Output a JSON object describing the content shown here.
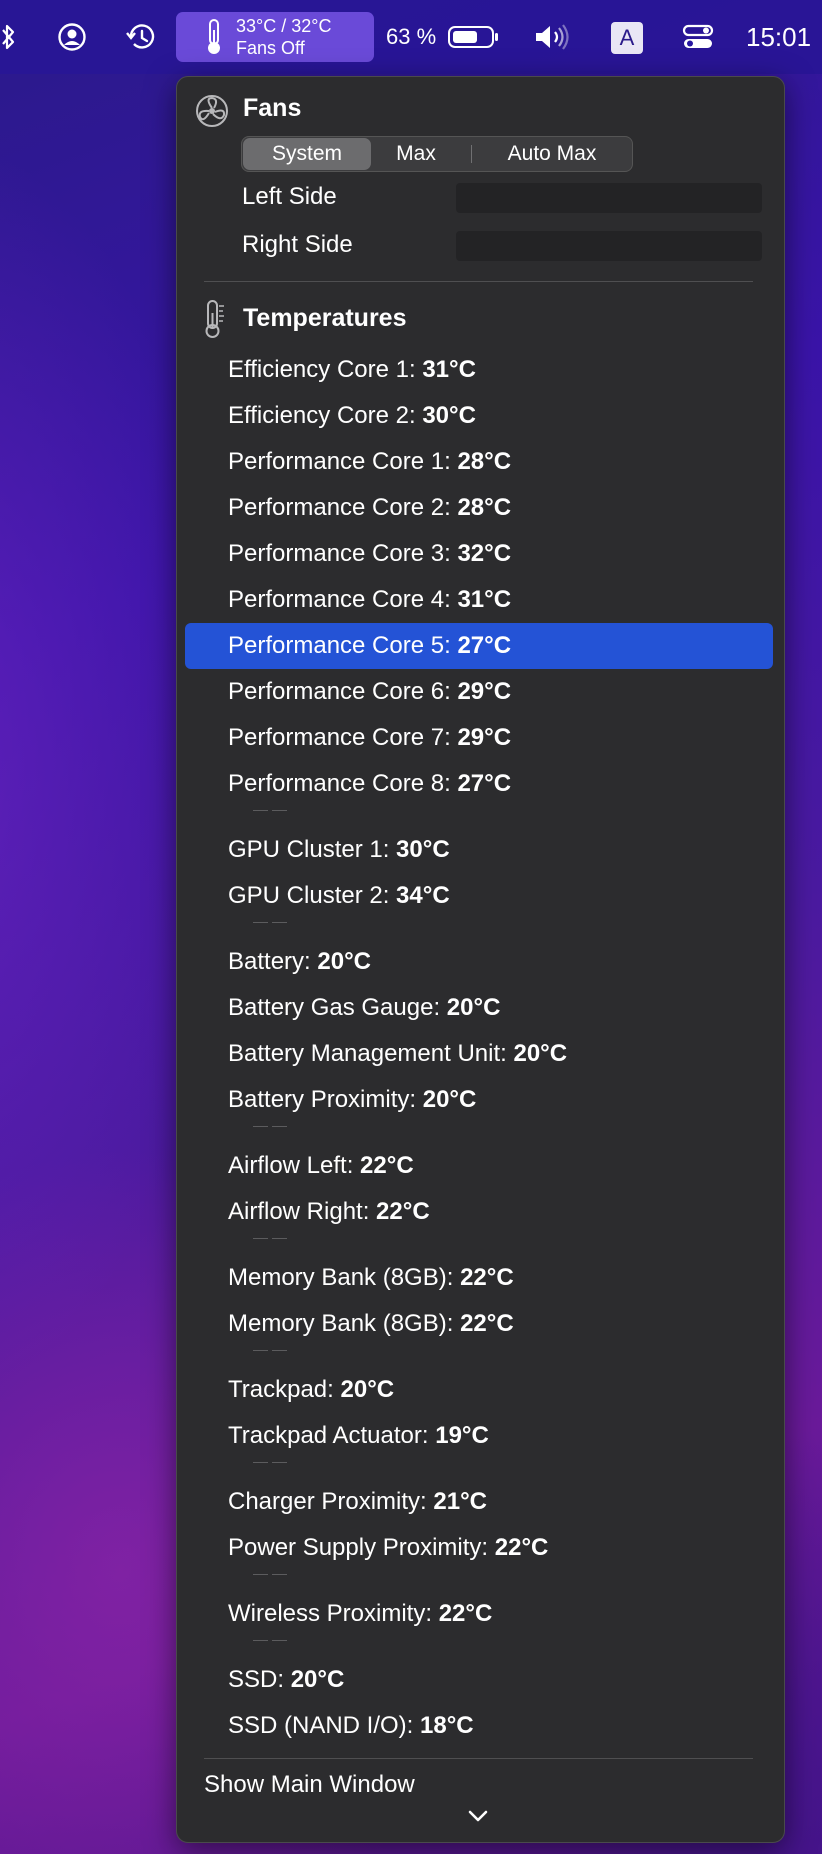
{
  "menubar": {
    "temp_line1": "33°C / 32°C",
    "temp_line2": "Fans Off",
    "battery": "63 %",
    "keyboard": "A",
    "clock": "15:01",
    "icons": [
      "bluetooth-icon",
      "user-icon",
      "time-machine-icon",
      "thermometer-icon",
      "battery-icon",
      "volume-icon",
      "input-source-icon",
      "control-center-icon"
    ]
  },
  "fans": {
    "title": "Fans",
    "modes": [
      "System",
      "Max",
      "Auto Max"
    ],
    "selected_mode": "System",
    "left_label": "Left Side",
    "right_label": "Right Side"
  },
  "temperatures": {
    "title": "Temperatures",
    "groups": [
      [
        {
          "label": "Efficiency Core 1: ",
          "value": "31°C"
        },
        {
          "label": "Efficiency Core 2: ",
          "value": "30°C"
        },
        {
          "label": "Performance Core 1: ",
          "value": "28°C"
        },
        {
          "label": "Performance Core 2: ",
          "value": "28°C"
        },
        {
          "label": "Performance Core 3: ",
          "value": "32°C"
        },
        {
          "label": "Performance Core 4: ",
          "value": "31°C"
        },
        {
          "label": "Performance Core 5: ",
          "value": "27°C",
          "selected": true
        },
        {
          "label": "Performance Core 6: ",
          "value": "29°C"
        },
        {
          "label": "Performance Core 7: ",
          "value": "29°C"
        },
        {
          "label": "Performance Core 8: ",
          "value": "27°C"
        }
      ],
      [
        {
          "label": "GPU Cluster 1: ",
          "value": "30°C"
        },
        {
          "label": "GPU Cluster 2: ",
          "value": "34°C"
        }
      ],
      [
        {
          "label": "Battery: ",
          "value": "20°C"
        },
        {
          "label": "Battery Gas Gauge: ",
          "value": "20°C"
        },
        {
          "label": "Battery Management Unit: ",
          "value": "20°C"
        },
        {
          "label": "Battery Proximity: ",
          "value": "20°C"
        }
      ],
      [
        {
          "label": "Airflow Left: ",
          "value": "22°C"
        },
        {
          "label": "Airflow Right: ",
          "value": "22°C"
        }
      ],
      [
        {
          "label": "Memory Bank (8GB): ",
          "value": "22°C"
        },
        {
          "label": "Memory Bank (8GB): ",
          "value": "22°C"
        }
      ],
      [
        {
          "label": "Trackpad: ",
          "value": "20°C"
        },
        {
          "label": "Trackpad Actuator: ",
          "value": "19°C"
        }
      ],
      [
        {
          "label": "Charger Proximity: ",
          "value": "21°C"
        },
        {
          "label": "Power Supply Proximity: ",
          "value": "22°C"
        }
      ],
      [
        {
          "label": "Wireless Proximity: ",
          "value": "22°C"
        }
      ],
      [
        {
          "label": "SSD: ",
          "value": "20°C"
        },
        {
          "label": "SSD (NAND I/O): ",
          "value": "18°C"
        }
      ]
    ]
  },
  "footer": {
    "show_main_window": "Show Main Window"
  },
  "colors": {
    "selection": "#2453d6",
    "panel": "#2c2c2e",
    "menubar": "#2816a0"
  }
}
